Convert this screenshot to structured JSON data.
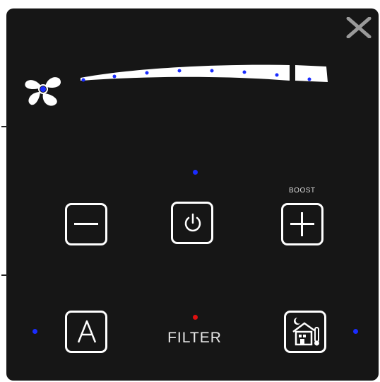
{
  "controls": {
    "close_icon": "close-icon",
    "fan_icon": "fan-icon",
    "speed_level": 1.0,
    "minus_icon": "minus-icon",
    "power_icon": "power-icon",
    "plus_icon": "plus-icon",
    "auto_icon": "auto-mode-icon",
    "home_icon": "house-night-thermometer-icon",
    "boost_label": "BOOST",
    "filter_label": "FILTER"
  },
  "colors": {
    "panel": "#161616",
    "indicator_blue": "#1a2cff",
    "indicator_red": "#e01010",
    "foreground": "#ffffff"
  }
}
